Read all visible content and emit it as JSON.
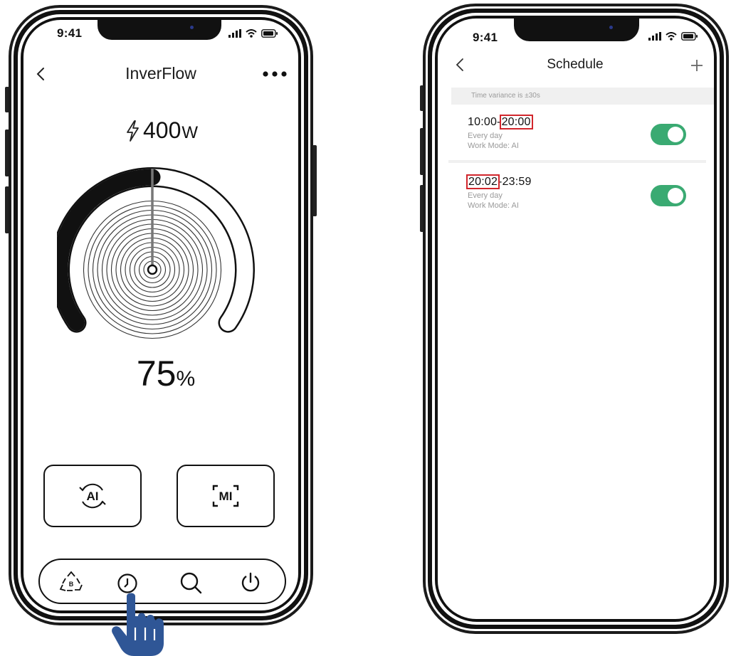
{
  "status_bar": {
    "time": "9:41"
  },
  "inverflow": {
    "title": "InverFlow",
    "power_value": "400",
    "power_unit": "W",
    "percent_value": "75",
    "percent_unit": "%",
    "level_percent": 75,
    "mode_buttons": [
      {
        "label": "AI",
        "icon": "ai-cycle-icon"
      },
      {
        "label": "MI",
        "icon": "mi-frame-icon"
      }
    ],
    "tabs": [
      {
        "icon": "recycle-b-icon",
        "letter": "B"
      },
      {
        "icon": "clock-icon"
      },
      {
        "icon": "search-icon"
      },
      {
        "icon": "power-icon"
      }
    ]
  },
  "schedule": {
    "title": "Schedule",
    "variance_note": "Time variance is ±30s",
    "items": [
      {
        "start": "10:00",
        "end": "20:00",
        "highlight": "end",
        "repeat": "Every day",
        "mode": "Work Mode: AI",
        "enabled": true
      },
      {
        "start": "20:02",
        "end": "23:59",
        "highlight": "start",
        "repeat": "Every day",
        "mode": "Work Mode: AI",
        "enabled": true
      }
    ]
  },
  "colors": {
    "accent_green": "#3aaa72",
    "highlight_red": "#d2262c",
    "hand_blue": "#2f5696"
  }
}
